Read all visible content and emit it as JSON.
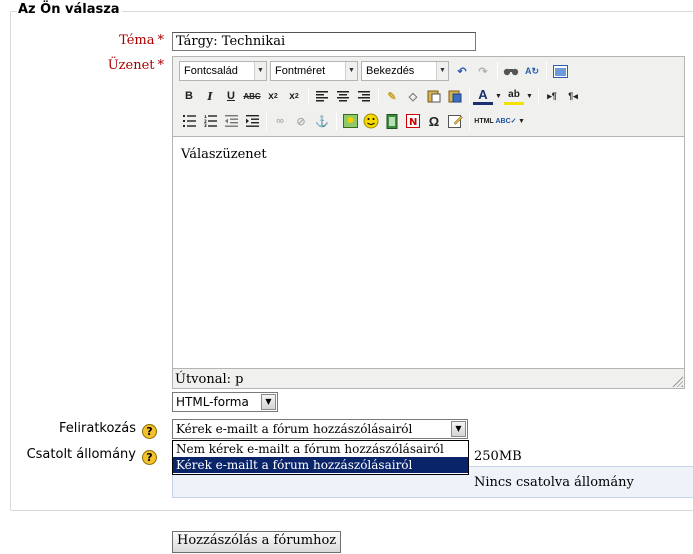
{
  "legend": "Az Ön válasza",
  "subject": {
    "label": "Téma",
    "value": "Tárgy: Technikai"
  },
  "message": {
    "label": "Üzenet"
  },
  "required_mark": "*",
  "editor": {
    "font_family": "Fontcsalád",
    "font_size": "Fontméret",
    "format": "Bekezdés",
    "content": "Válaszüzenet",
    "path": "Útvonal: p",
    "toolbar_icons_row1": [
      "undo-icon",
      "redo-icon",
      "find-icon",
      "replace-icon",
      "fullscreen-icon"
    ],
    "toolbar_icons_row2": [
      "bold-icon",
      "italic-icon",
      "underline-icon",
      "strikethrough-icon",
      "subscript-icon",
      "superscript-icon",
      "align-left-icon",
      "align-center-icon",
      "align-right-icon",
      "clean-icon",
      "eraser-icon",
      "paste-text-icon",
      "paste-word-icon",
      "text-color-icon",
      "background-color-icon",
      "ltr-icon",
      "rtl-icon"
    ],
    "toolbar_icons_row3": [
      "bullet-list-icon",
      "numbered-list-icon",
      "outdent-icon",
      "indent-icon",
      "link-icon",
      "unlink-icon",
      "anchor-icon",
      "image-icon",
      "emoticon-icon",
      "media-icon",
      "nolink-icon",
      "special-char-icon",
      "edit-icon",
      "html-icon",
      "spellcheck-icon"
    ]
  },
  "format_select": "HTML-forma",
  "subscription": {
    "label": "Feliratkozás",
    "value": "Kérek e-mailt a fórum hozzászólásairól",
    "options": [
      "Nem kérek e-mailt a fórum hozzászólásairól",
      "Kérek e-mailt a fórum hozzászólásairól"
    ]
  },
  "attachment": {
    "label": "Csatolt állomány",
    "size": "250MB",
    "empty": "Nincs csatolva állomány"
  },
  "submit_label": "Hozzászólás a fórumhoz",
  "help_glyph": "?"
}
